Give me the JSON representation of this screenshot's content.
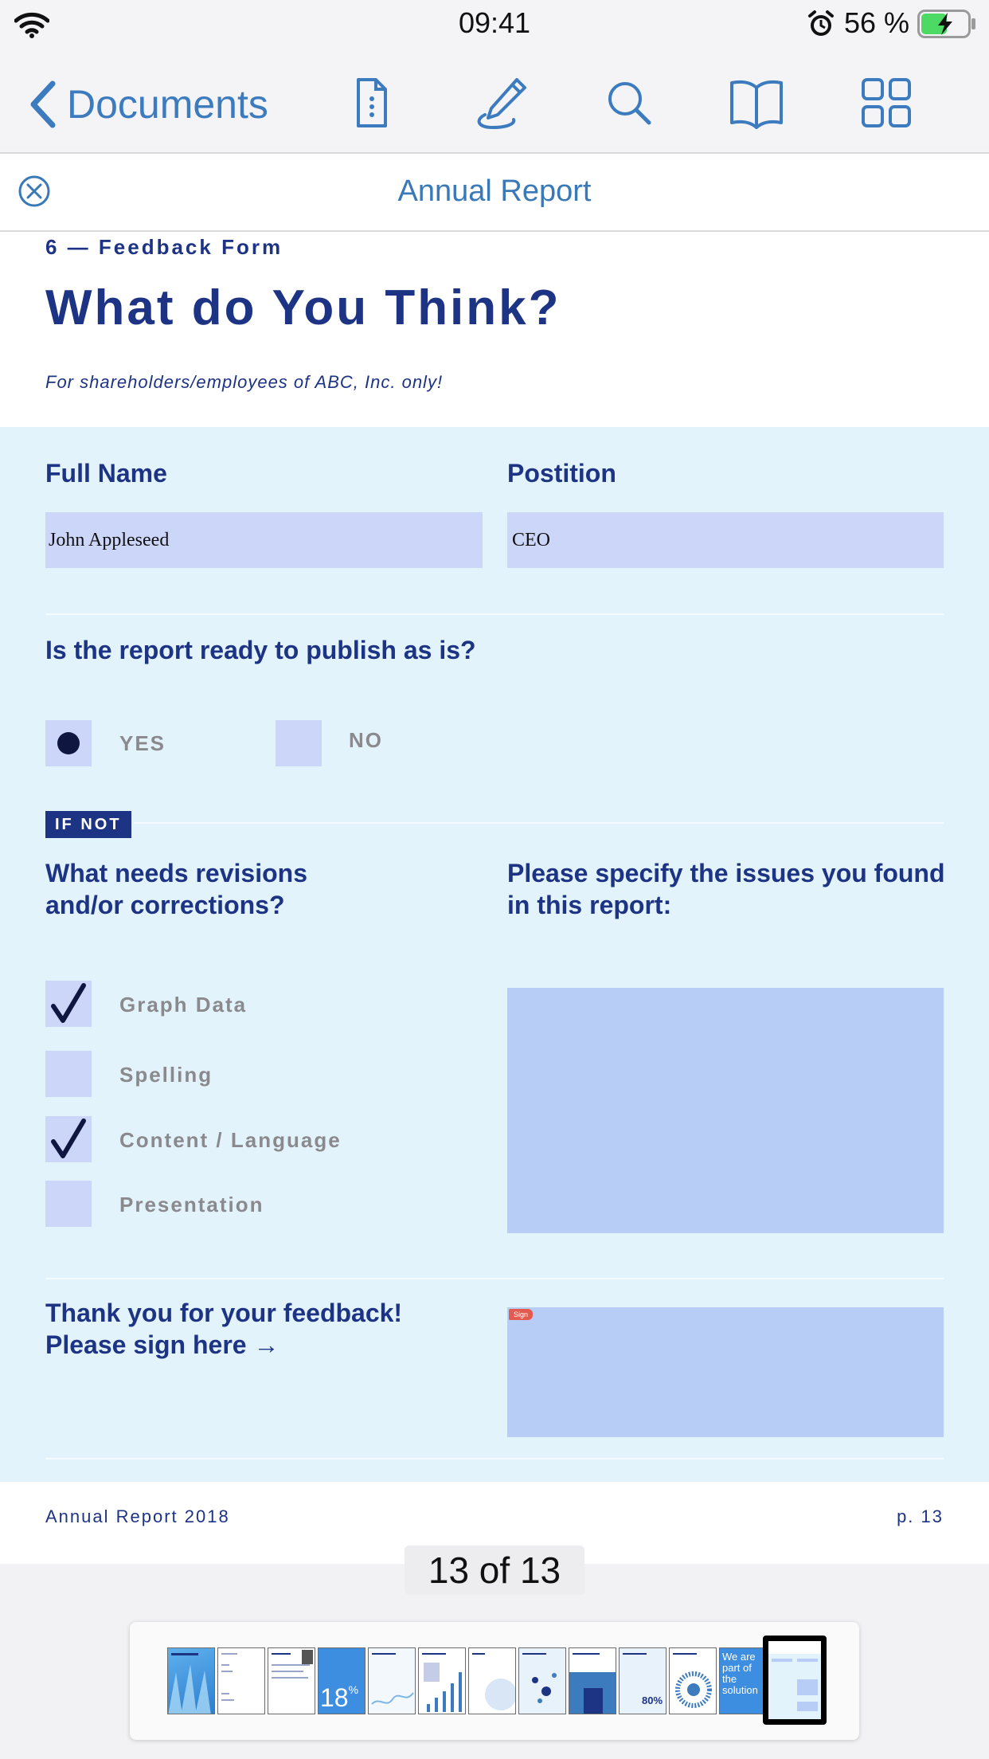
{
  "status_bar": {
    "time": "09:41",
    "battery_percent": "56 %",
    "battery_level": 0.56,
    "icons": [
      "wifi-icon",
      "alarm-icon",
      "battery-charging-icon"
    ]
  },
  "toolbar": {
    "back_label": "Documents",
    "icons": [
      "document-info-icon",
      "annotate-pen-icon",
      "search-icon",
      "reader-book-icon",
      "thumbnail-grid-icon"
    ]
  },
  "document": {
    "title": "Annual Report"
  },
  "page": {
    "section": "6 — Feedback Form",
    "heading": "What do You Think?",
    "subtitle": "For shareholders/employees of ABC, Inc. only!",
    "form": {
      "full_name_label": "Full Name",
      "full_name_value": "John  Appleseed",
      "position_label": "Postition",
      "position_value": "CEO",
      "question_publish": "Is the report ready to publish as is?",
      "yes_label": "YES",
      "yes_selected": true,
      "no_label": "NO",
      "no_selected": false,
      "if_not": "IF NOT",
      "revisions_q_line1": "What needs revisions",
      "revisions_q_line2": "and/or corrections?",
      "issues_q_line1": "Please specify the issues you found",
      "issues_q_line2": "in this report:",
      "checklist": [
        {
          "label": "Graph Data",
          "checked": true
        },
        {
          "label": "Spelling",
          "checked": false
        },
        {
          "label": "Content / Language",
          "checked": true
        },
        {
          "label": "Presentation",
          "checked": false
        }
      ],
      "issues_value": "",
      "thanks_line1": "Thank you for your feedback!",
      "thanks_line2": "Please sign here →",
      "sign_tag": "Sign"
    },
    "footer_left": "Annual Report 2018",
    "footer_right": "p. 13"
  },
  "page_indicator": "13 of 13",
  "thumbnails": {
    "count": 13,
    "current": 13,
    "texts": {
      "page4": "18",
      "page4_unit": "%",
      "page11": "80%",
      "page12": "We are part of the solution"
    }
  },
  "colors": {
    "accent": "#3d7bbf",
    "navy": "#1d3384",
    "form_bg": "#e3f3fb",
    "field": "#ccd6f9",
    "textarea": "#b7cdf6"
  }
}
